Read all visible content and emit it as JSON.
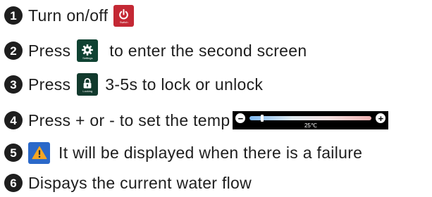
{
  "items": [
    {
      "number": "1",
      "text": "Turn on/off",
      "icon": "power-icon",
      "icon_caption": "Switch"
    },
    {
      "number": "2",
      "before": "Press",
      "after": "to enter the second screen",
      "icon": "gear-icon",
      "icon_caption": "Settings"
    },
    {
      "number": "3",
      "before": "Press",
      "after": "3-5s to lock or unlock",
      "icon": "lock-icon",
      "icon_caption": "Locking"
    },
    {
      "number": "4",
      "text": "Press + or - to set the temp",
      "minus": "−",
      "plus": "+",
      "temp_value": "25℃",
      "temp_level": 0.1
    },
    {
      "number": "5",
      "text": "It will be displayed when there is a failure",
      "icon": "warning-icon"
    },
    {
      "number": "6",
      "text": "Dispays the current water flow"
    }
  ],
  "colors": {
    "power": "#c42834",
    "settings": "#0f4232",
    "lock": "#123a2d",
    "warning_bg": "#2a68c9",
    "warning_fg": "#f5a623"
  }
}
